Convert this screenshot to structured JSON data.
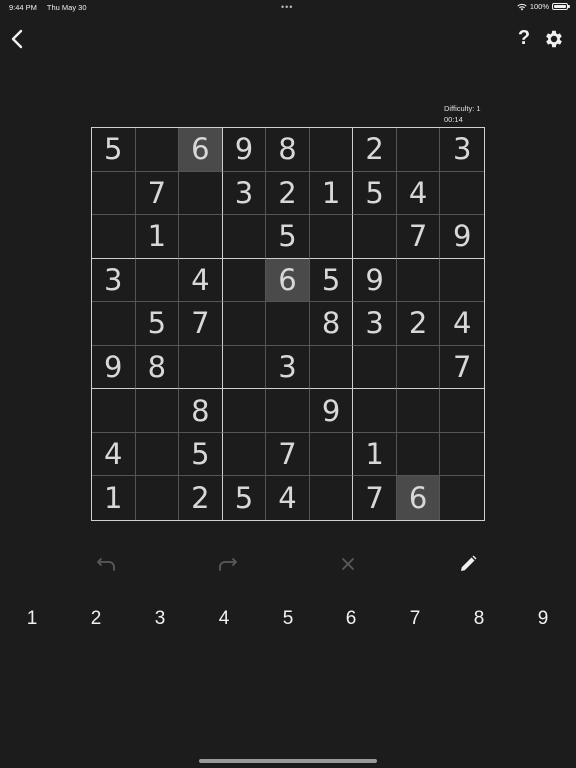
{
  "status": {
    "time": "9:44 PM",
    "date": "Thu May 30",
    "dots": "•••",
    "battery": "100%"
  },
  "nav": {
    "back_icon": "chevron-left-icon",
    "help_label": "?",
    "settings_icon": "gear-icon"
  },
  "info": {
    "difficulty": "Difficulty: 1",
    "timer": "00:14"
  },
  "board": {
    "grid": [
      [
        "5",
        "",
        "6",
        "9",
        "8",
        "",
        "2",
        "",
        "3"
      ],
      [
        "",
        "7",
        "",
        "3",
        "2",
        "1",
        "5",
        "4",
        ""
      ],
      [
        "",
        "1",
        "",
        "",
        "5",
        "",
        "",
        "7",
        "9"
      ],
      [
        "3",
        "",
        "4",
        "",
        "6",
        "5",
        "9",
        "",
        ""
      ],
      [
        "",
        "5",
        "7",
        "",
        "",
        "8",
        "3",
        "2",
        "4"
      ],
      [
        "9",
        "8",
        "",
        "",
        "3",
        "",
        "",
        "",
        "7"
      ],
      [
        "",
        "",
        "8",
        "",
        "",
        "9",
        "",
        "",
        ""
      ],
      [
        "4",
        "",
        "5",
        "",
        "7",
        "",
        "1",
        "",
        ""
      ],
      [
        "1",
        "",
        "2",
        "5",
        "4",
        "",
        "7",
        "6",
        ""
      ]
    ],
    "highlighted_cells": [
      [
        0,
        2
      ],
      [
        3,
        4
      ],
      [
        8,
        7
      ]
    ]
  },
  "toolbar": {
    "undo_icon": "undo-icon",
    "redo_icon": "redo-icon",
    "erase_icon": "close-icon",
    "pencil_icon": "pencil-icon"
  },
  "numpad": {
    "keys": [
      "1",
      "2",
      "3",
      "4",
      "5",
      "6",
      "7",
      "8",
      "9"
    ]
  },
  "colors": {
    "background": "#1c1c1c",
    "highlight": "#4a4a4a",
    "text": "#d8d8d8"
  }
}
